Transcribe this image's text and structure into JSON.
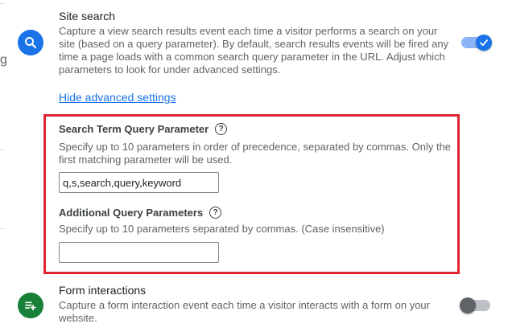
{
  "site_search": {
    "title": "Site search",
    "description": "Capture a view search results event each time a visitor performs a search on your site (based on a query parameter). By default, search results events will be fired any time a page loads with a common search query parameter in the URL. Adjust which parameters to look for under advanced settings.",
    "icon": "search-icon",
    "enabled": true,
    "toggle_color": "#1a73e8",
    "hide_advanced_label": "Hide advanced settings"
  },
  "advanced": {
    "highlight_color": "#e0232e",
    "search_term": {
      "label": "Search Term Query Parameter",
      "help_icon": "help-circle-icon",
      "help_glyph": "?",
      "description": "Specify up to 10 parameters in order of precedence, separated by commas. Only the first matching parameter will be used.",
      "value": "q,s,search,query,keyword"
    },
    "additional": {
      "label": "Additional Query Parameters",
      "help_icon": "help-circle-icon",
      "help_glyph": "?",
      "description": "Specify up to 10 parameters separated by commas. (Case insensitive)",
      "value": ""
    }
  },
  "form_interactions": {
    "title": "Form interactions",
    "description": "Capture a form interaction event each time a visitor interacts with a form on your website.",
    "icon": "playlist-add-icon",
    "icon_color": "#188038",
    "enabled": false
  }
}
